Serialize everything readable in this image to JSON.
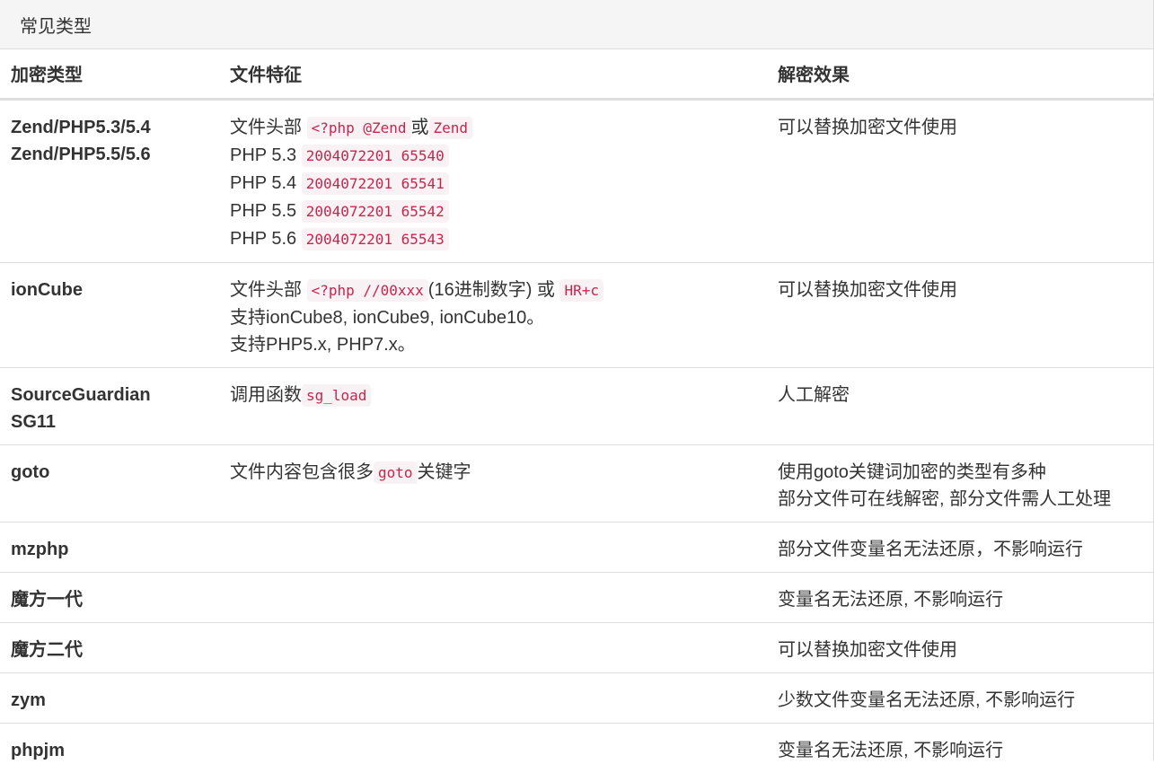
{
  "panel": {
    "title": "常见类型"
  },
  "headers": {
    "type": "加密类型",
    "feature": "文件特征",
    "effect": "解密效果"
  },
  "rows": [
    {
      "type": [
        "Zend/PHP5.3/5.4",
        "Zend/PHP5.5/5.6"
      ],
      "feature": [
        {
          "a": "文件头部 ",
          "c1": "<?php @Zend",
          "b": "或",
          "c2": "Zend"
        },
        {
          "a": "PHP 5.3 ",
          "c1": "2004072201 65540"
        },
        {
          "a": "PHP 5.4 ",
          "c1": "2004072201 65541"
        },
        {
          "a": "PHP 5.5 ",
          "c1": "2004072201 65542"
        },
        {
          "a": "PHP 5.6 ",
          "c1": "2004072201 65543"
        }
      ],
      "effect": [
        "可以替换加密文件使用"
      ]
    },
    {
      "type": [
        "ionCube"
      ],
      "feature": [
        {
          "a": "文件头部 ",
          "c1": "<?php //00xxx",
          "b": "(16进制数字) 或 ",
          "c2": "HR+c"
        },
        {
          "a": "支持ionCube8, ionCube9, ionCube10。"
        },
        {
          "a": "支持PHP5.x, PHP7.x。"
        }
      ],
      "effect": [
        "可以替换加密文件使用"
      ]
    },
    {
      "type": [
        "SourceGuardian",
        "SG11"
      ],
      "feature": [
        {
          "a": "调用函数",
          "c1": "sg_load"
        }
      ],
      "effect": [
        "人工解密"
      ]
    },
    {
      "type": [
        "goto"
      ],
      "feature": [
        {
          "a": "文件内容包含很多",
          "c1": "goto",
          "b": "关键字"
        }
      ],
      "effect": [
        "使用goto关键词加密的类型有多种",
        "部分文件可在线解密, 部分文件需人工处理"
      ]
    },
    {
      "type": [
        "mzphp"
      ],
      "feature": [],
      "effect": [
        "部分文件变量名无法还原，不影响运行"
      ]
    },
    {
      "type": [
        "魔方一代"
      ],
      "feature": [],
      "effect": [
        "变量名无法还原, 不影响运行"
      ]
    },
    {
      "type": [
        "魔方二代"
      ],
      "feature": [],
      "effect": [
        "可以替换加密文件使用"
      ]
    },
    {
      "type": [
        "zym"
      ],
      "feature": [],
      "effect": [
        "少数文件变量名无法还原, 不影响运行"
      ]
    },
    {
      "type": [
        "phpjm"
      ],
      "feature": [],
      "effect": [
        "变量名无法还原, 不影响运行"
      ]
    }
  ]
}
